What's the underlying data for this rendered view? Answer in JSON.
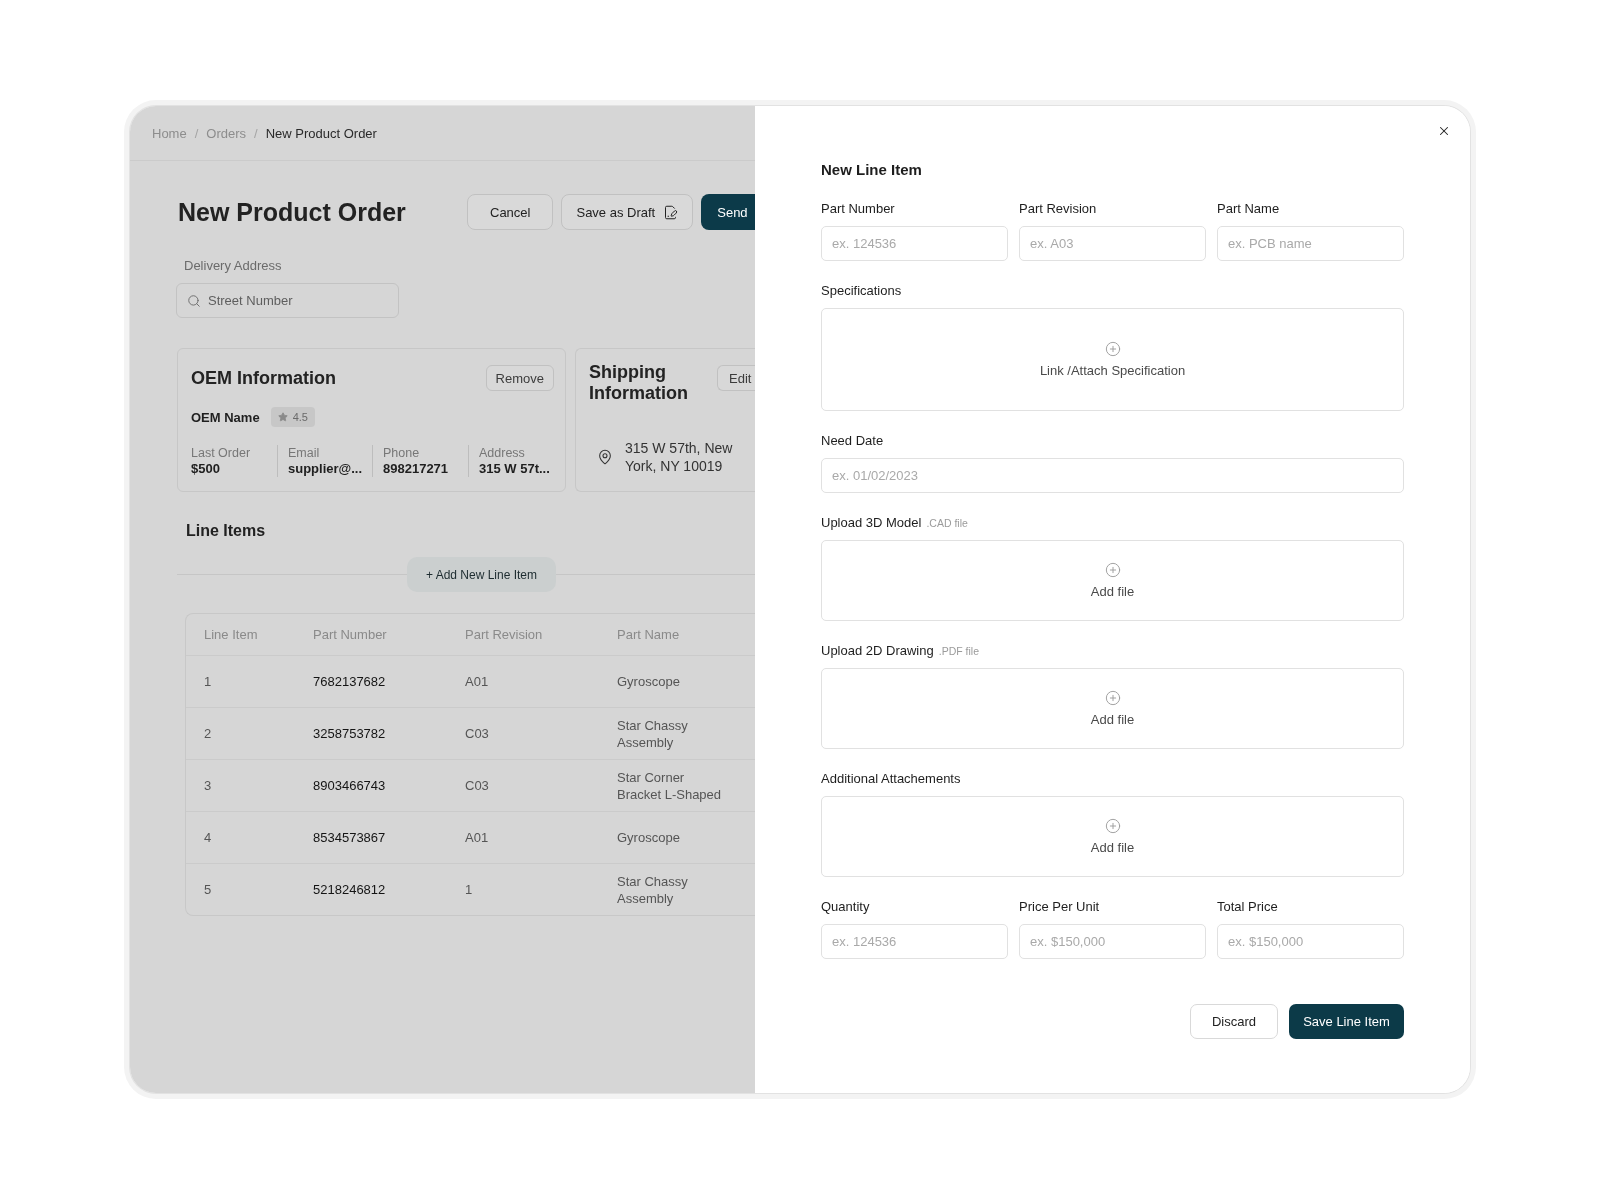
{
  "breadcrumb": {
    "separator": "/",
    "items": [
      {
        "label": "Home",
        "current": false
      },
      {
        "label": "Orders",
        "current": false
      },
      {
        "label": "New Product Order",
        "current": true
      }
    ]
  },
  "page": {
    "title": "New Product Order",
    "actions": [
      {
        "label": "Cancel",
        "kind": "outline"
      },
      {
        "label": "Save as Draft",
        "kind": "draft"
      },
      {
        "label": "Send",
        "kind": "primary"
      }
    ]
  },
  "delivery_address": {
    "label": "Delivery Address",
    "placeholder": "Street Number"
  },
  "oem_card": {
    "title": "OEM Information",
    "action": "Remove",
    "name": "OEM Name",
    "rating": "4.5",
    "stats": [
      {
        "label": "Last Order",
        "value": "$500"
      },
      {
        "label": "Email",
        "value": "supplier@..."
      },
      {
        "label": "Phone",
        "value": "898217271"
      },
      {
        "label": "Address",
        "value": "315 W 57t..."
      }
    ]
  },
  "shipping_card": {
    "title": "Shipping Information",
    "action": "Edit",
    "address": "315 W 57th, New York, NY 10019"
  },
  "line_items": {
    "title": "Line Items",
    "add_button": "+ Add New Line Item",
    "table": {
      "columns": [
        "Line Item",
        "Part Number",
        "Part Revision",
        "Part Name"
      ],
      "rows": [
        [
          "1",
          "7682137682",
          "A01",
          "Gyroscope"
        ],
        [
          "2",
          "3258753782",
          "C03",
          "Star Chassy Assembly"
        ],
        [
          "3",
          "8903466743",
          "C03",
          "Star Corner Bracket L-Shaped"
        ],
        [
          "4",
          "8534573867",
          "A01",
          "Gyroscope"
        ],
        [
          "5",
          "5218246812",
          "1",
          "Star Chassy Assembly"
        ]
      ]
    }
  },
  "drawer": {
    "title": "New Line Item",
    "sections": [
      {
        "kind": "field_row",
        "fields": [
          {
            "label": "Part Number",
            "placeholder": "ex. 124536"
          },
          {
            "label": "Part Revision",
            "placeholder": "ex. A03"
          },
          {
            "label": "Part Name",
            "placeholder": "ex. PCB name"
          }
        ]
      },
      {
        "kind": "attach",
        "label": "Specifications",
        "action": "Link /Attach Specification"
      },
      {
        "kind": "field",
        "label": "Need Date",
        "placeholder": "ex. 01/02/2023"
      },
      {
        "kind": "upload",
        "label": "Upload 3D Model",
        "hint": ".CAD file",
        "action": "Add file"
      },
      {
        "kind": "upload",
        "label": "Upload 2D Drawing",
        "hint": ".PDF file",
        "action": "Add file"
      },
      {
        "kind": "upload",
        "label": "Additional Attachements",
        "action": "Add file"
      },
      {
        "kind": "field_row",
        "fields": [
          {
            "label": "Quantity",
            "placeholder": "ex. 124536"
          },
          {
            "label": "Price Per Unit",
            "placeholder": "ex. $150,000"
          },
          {
            "label": "Total Price",
            "placeholder": "ex. $150,000"
          }
        ]
      }
    ],
    "buttons": [
      {
        "label": "Discard",
        "kind": "secondary"
      },
      {
        "label": "Save Line Item",
        "kind": "primary"
      }
    ]
  }
}
